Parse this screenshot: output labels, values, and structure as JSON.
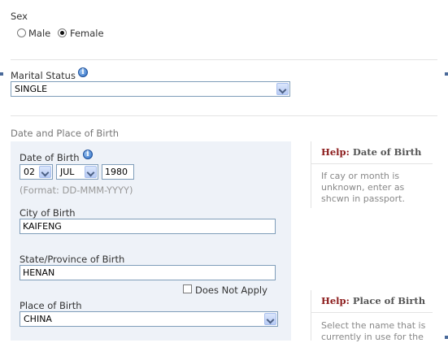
{
  "sex": {
    "label": "Sex",
    "options": [
      {
        "label": "Male",
        "checked": false
      },
      {
        "label": "Female",
        "checked": true
      }
    ]
  },
  "marital_status": {
    "label": "Marital Status",
    "value": "SINGLE"
  },
  "date_place_section": {
    "title": "Date and Place of Birth"
  },
  "date_of_birth": {
    "label": "Date of Birth",
    "day": "02",
    "month": "JUL",
    "year": "1980",
    "format_hint": "(Format: DD-MMM-YYYY)"
  },
  "city_of_birth": {
    "label": "City of Birth",
    "value": "KAIFENG"
  },
  "state_of_birth": {
    "label": "State/Province of Birth",
    "value": "HENAN",
    "does_not_apply_label": "Does Not Apply"
  },
  "place_of_birth": {
    "label": "Place of Birth",
    "value": "CHINA"
  },
  "help_dob": {
    "prefix": "Help:",
    "title": "Date of Birth",
    "lines": [
      "If cay or month is",
      "unknown, enter as",
      "shcwn in passport."
    ]
  },
  "help_pob": {
    "prefix": "Help:",
    "title": "Place of Birth",
    "lines": [
      "Select the name that is",
      "currently in use for the"
    ]
  },
  "colors": {
    "panel_bg": "#eef2f8",
    "help_accent": "#8b1a1a",
    "input_border": "#7f9db9"
  }
}
